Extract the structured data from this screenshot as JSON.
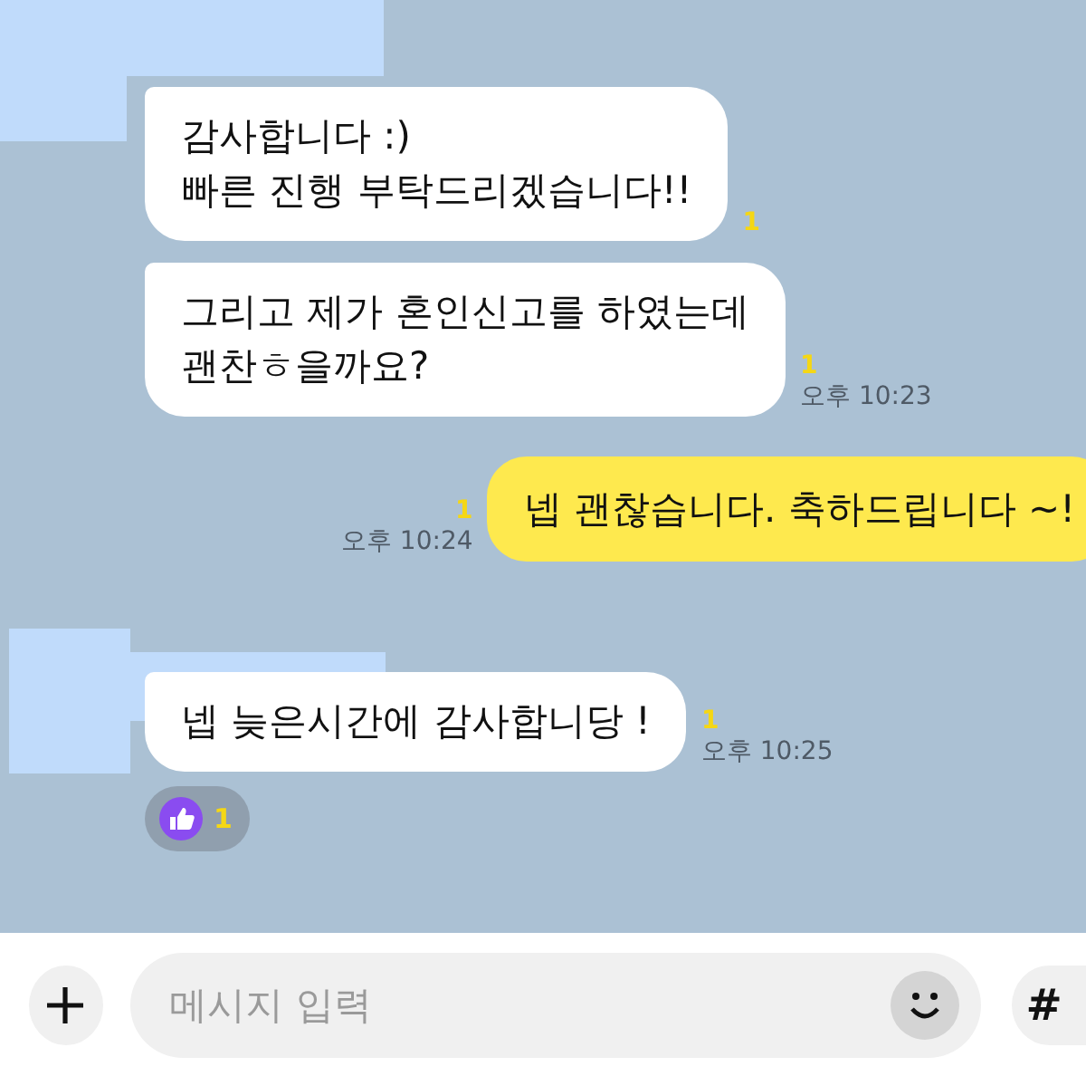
{
  "messages": [
    {
      "kind": "received",
      "lines": [
        "감사합니다 :)",
        "빠른 진행 부탁드리겠습니다!!"
      ],
      "unread": "1"
    },
    {
      "kind": "received",
      "lines": [
        "그리고 제가 혼인신고를 하였는데",
        "괜찬ㅎ을까요?"
      ],
      "unread": "1",
      "time": "오후 10:23"
    },
    {
      "kind": "sent",
      "lines": [
        "넵 괜찮습니다. 축하드립니다 ~!"
      ],
      "unread": "1",
      "time": "오후 10:24"
    },
    {
      "kind": "received",
      "lines": [
        "넵 늦은시간에 감사합니당 !"
      ],
      "unread": "1",
      "time": "오후 10:25",
      "reaction": {
        "count": "1"
      }
    }
  ],
  "composer": {
    "placeholder": "메시지 입력",
    "hash_button": "#"
  }
}
